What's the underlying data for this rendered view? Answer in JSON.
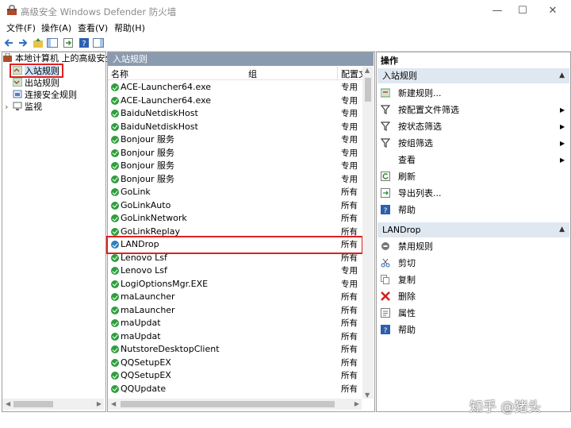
{
  "window": {
    "title": "高级安全 Windows Defender 防火墙",
    "minimize": "—",
    "maximize": "☐",
    "close": "✕"
  },
  "menu": [
    "文件(F)",
    "操作(A)",
    "查看(V)",
    "帮助(H)"
  ],
  "tree": {
    "root": "本地计算机 上的高级安全",
    "items": [
      "入站规则",
      "出站规则",
      "连接安全规则",
      "监视"
    ]
  },
  "grid": {
    "panel_title": "入站规则",
    "columns": {
      "name": "名称",
      "group": "组",
      "profile": "配置文"
    },
    "rows": [
      {
        "name": "ACE-Launcher64.exe",
        "profile": "专用"
      },
      {
        "name": "ACE-Launcher64.exe",
        "profile": "专用"
      },
      {
        "name": "BaiduNetdiskHost",
        "profile": "专用"
      },
      {
        "name": "BaiduNetdiskHost",
        "profile": "专用"
      },
      {
        "name": "Bonjour 服务",
        "profile": "专用"
      },
      {
        "name": "Bonjour 服务",
        "profile": "专用"
      },
      {
        "name": "Bonjour 服务",
        "profile": "专用"
      },
      {
        "name": "Bonjour 服务",
        "profile": "专用"
      },
      {
        "name": "GoLink",
        "profile": "所有"
      },
      {
        "name": "GoLinkAuto",
        "profile": "所有"
      },
      {
        "name": "GoLinkNetwork",
        "profile": "所有"
      },
      {
        "name": "GoLinkReplay",
        "profile": "所有"
      },
      {
        "name": "LANDrop",
        "profile": "所有"
      },
      {
        "name": "Lenovo Lsf",
        "profile": "所有"
      },
      {
        "name": "Lenovo Lsf",
        "profile": "专用"
      },
      {
        "name": "LogiOptionsMgr.EXE",
        "profile": "专用"
      },
      {
        "name": "maLauncher",
        "profile": "所有"
      },
      {
        "name": "maLauncher",
        "profile": "所有"
      },
      {
        "name": "maUpdat",
        "profile": "所有"
      },
      {
        "name": "maUpdat",
        "profile": "所有"
      },
      {
        "name": "NutstoreDesktopClient",
        "profile": "所有"
      },
      {
        "name": "QQSetupEX",
        "profile": "所有"
      },
      {
        "name": "QQSetupEX",
        "profile": "所有"
      },
      {
        "name": "QQUpdate",
        "profile": "所有"
      }
    ]
  },
  "actions": {
    "title": "操作",
    "section1": "入站规则",
    "items1": [
      "新建规则...",
      "按配置文件筛选",
      "按状态筛选",
      "按组筛选",
      "查看",
      "刷新",
      "导出列表...",
      "帮助"
    ],
    "section2": "LANDrop",
    "items2": [
      "禁用规则",
      "剪切",
      "复制",
      "删除",
      "属性",
      "帮助"
    ]
  },
  "watermark": "知乎 @猪头",
  "colors": {
    "highlight": "#e02020",
    "enabled_dot": "#2e9e3e",
    "section_header": "#dfe7f1"
  }
}
